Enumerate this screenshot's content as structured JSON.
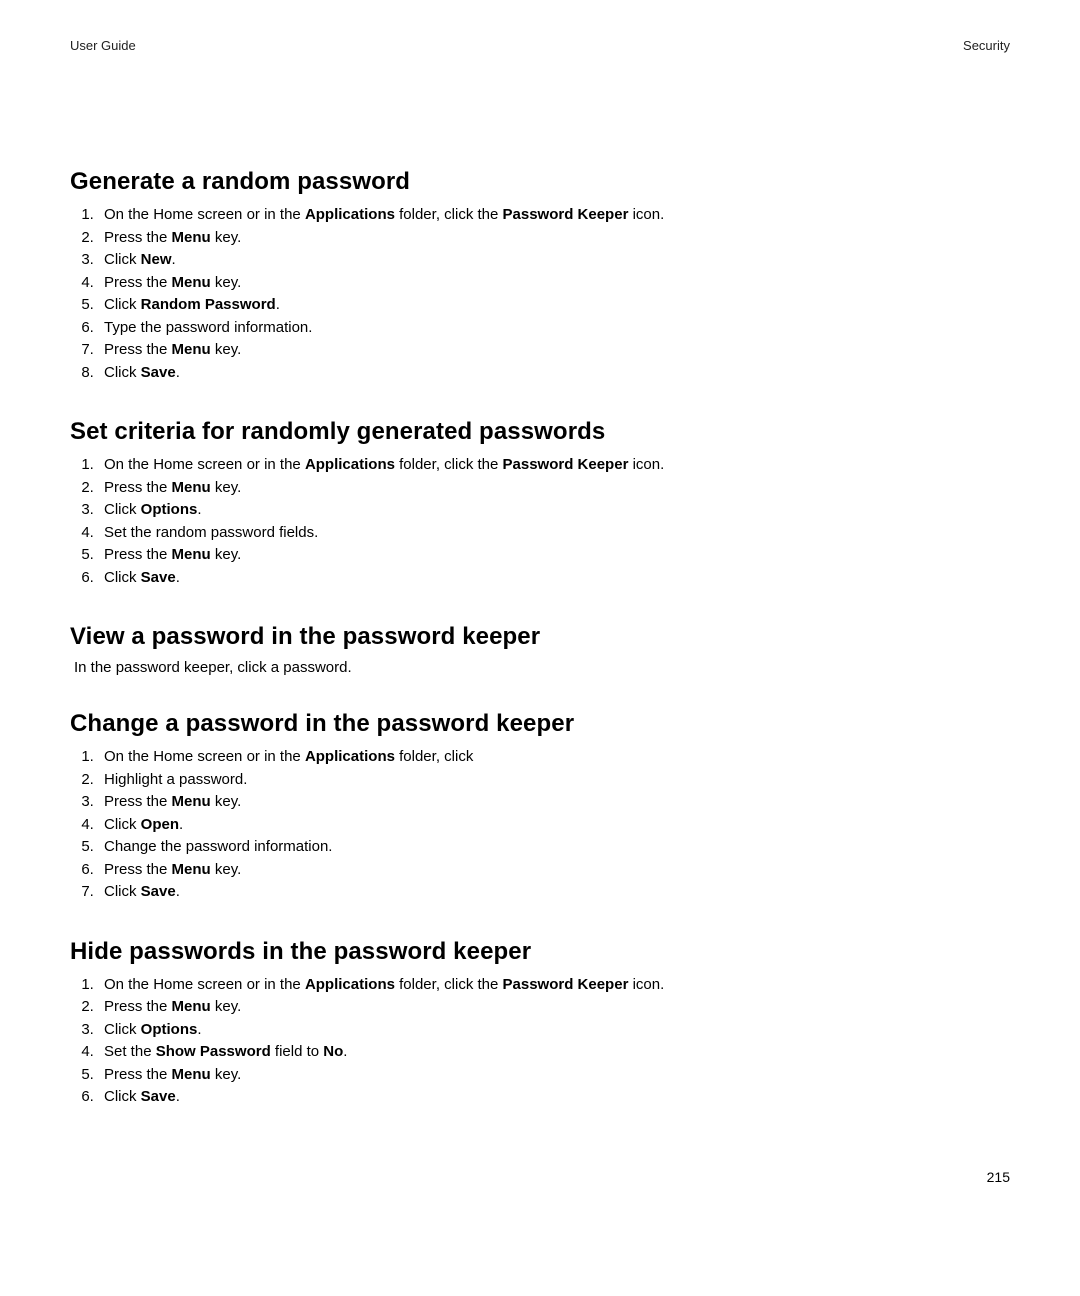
{
  "header": {
    "left": "User Guide",
    "right": "Security"
  },
  "sections": [
    {
      "title": "Generate a random password",
      "steps": [
        [
          {
            "t": "On the Home screen or in the "
          },
          {
            "t": "Applications",
            "b": true
          },
          {
            "t": " folder, click the "
          },
          {
            "t": "Password Keeper",
            "b": true
          },
          {
            "t": " icon."
          }
        ],
        [
          {
            "t": "Press the "
          },
          {
            "t": "Menu",
            "b": true
          },
          {
            "t": " key."
          }
        ],
        [
          {
            "t": "Click "
          },
          {
            "t": "New",
            "b": true
          },
          {
            "t": "."
          }
        ],
        [
          {
            "t": "Press the "
          },
          {
            "t": "Menu",
            "b": true
          },
          {
            "t": " key."
          }
        ],
        [
          {
            "t": "Click "
          },
          {
            "t": "Random Password",
            "b": true
          },
          {
            "t": "."
          }
        ],
        [
          {
            "t": "Type the password information."
          }
        ],
        [
          {
            "t": "Press the "
          },
          {
            "t": "Menu",
            "b": true
          },
          {
            "t": " key."
          }
        ],
        [
          {
            "t": "Click "
          },
          {
            "t": "Save",
            "b": true
          },
          {
            "t": "."
          }
        ]
      ]
    },
    {
      "title": "Set criteria for randomly generated passwords",
      "steps": [
        [
          {
            "t": "On the Home screen or in the "
          },
          {
            "t": "Applications",
            "b": true
          },
          {
            "t": " folder, click the "
          },
          {
            "t": "Password Keeper",
            "b": true
          },
          {
            "t": " icon."
          }
        ],
        [
          {
            "t": "Press the "
          },
          {
            "t": "Menu",
            "b": true
          },
          {
            "t": " key."
          }
        ],
        [
          {
            "t": "Click "
          },
          {
            "t": "Options",
            "b": true
          },
          {
            "t": "."
          }
        ],
        [
          {
            "t": "Set the random password fields."
          }
        ],
        [
          {
            "t": "Press the "
          },
          {
            "t": "Menu",
            "b": true
          },
          {
            "t": " key."
          }
        ],
        [
          {
            "t": "Click "
          },
          {
            "t": "Save",
            "b": true
          },
          {
            "t": "."
          }
        ]
      ]
    },
    {
      "title": "View a password in the password keeper",
      "body": "In the password keeper, click a password."
    },
    {
      "title": "Change a password in the password keeper",
      "steps": [
        [
          {
            "t": "On the Home screen or in the "
          },
          {
            "t": "Applications",
            "b": true
          },
          {
            "t": " folder, click"
          }
        ],
        [
          {
            "t": "Highlight a password."
          }
        ],
        [
          {
            "t": "Press the "
          },
          {
            "t": "Menu",
            "b": true
          },
          {
            "t": " key."
          }
        ],
        [
          {
            "t": "Click "
          },
          {
            "t": "Open",
            "b": true
          },
          {
            "t": "."
          }
        ],
        [
          {
            "t": "Change the password information."
          }
        ],
        [
          {
            "t": "Press the "
          },
          {
            "t": "Menu",
            "b": true
          },
          {
            "t": " key."
          }
        ],
        [
          {
            "t": "Click "
          },
          {
            "t": "Save",
            "b": true
          },
          {
            "t": "."
          }
        ]
      ]
    },
    {
      "title": "Hide passwords in the password keeper",
      "steps": [
        [
          {
            "t": "On the Home screen or in the "
          },
          {
            "t": "Applications",
            "b": true
          },
          {
            "t": " folder, click the "
          },
          {
            "t": "Password Keeper",
            "b": true
          },
          {
            "t": " icon."
          }
        ],
        [
          {
            "t": "Press the "
          },
          {
            "t": "Menu",
            "b": true
          },
          {
            "t": " key."
          }
        ],
        [
          {
            "t": "Click "
          },
          {
            "t": "Options",
            "b": true
          },
          {
            "t": "."
          }
        ],
        [
          {
            "t": "Set the "
          },
          {
            "t": "Show Password",
            "b": true
          },
          {
            "t": " field to "
          },
          {
            "t": "No",
            "b": true
          },
          {
            "t": "."
          }
        ],
        [
          {
            "t": "Press the "
          },
          {
            "t": "Menu",
            "b": true
          },
          {
            "t": " key."
          }
        ],
        [
          {
            "t": "Click "
          },
          {
            "t": "Save",
            "b": true
          },
          {
            "t": "."
          }
        ]
      ]
    }
  ],
  "page_number": "215"
}
